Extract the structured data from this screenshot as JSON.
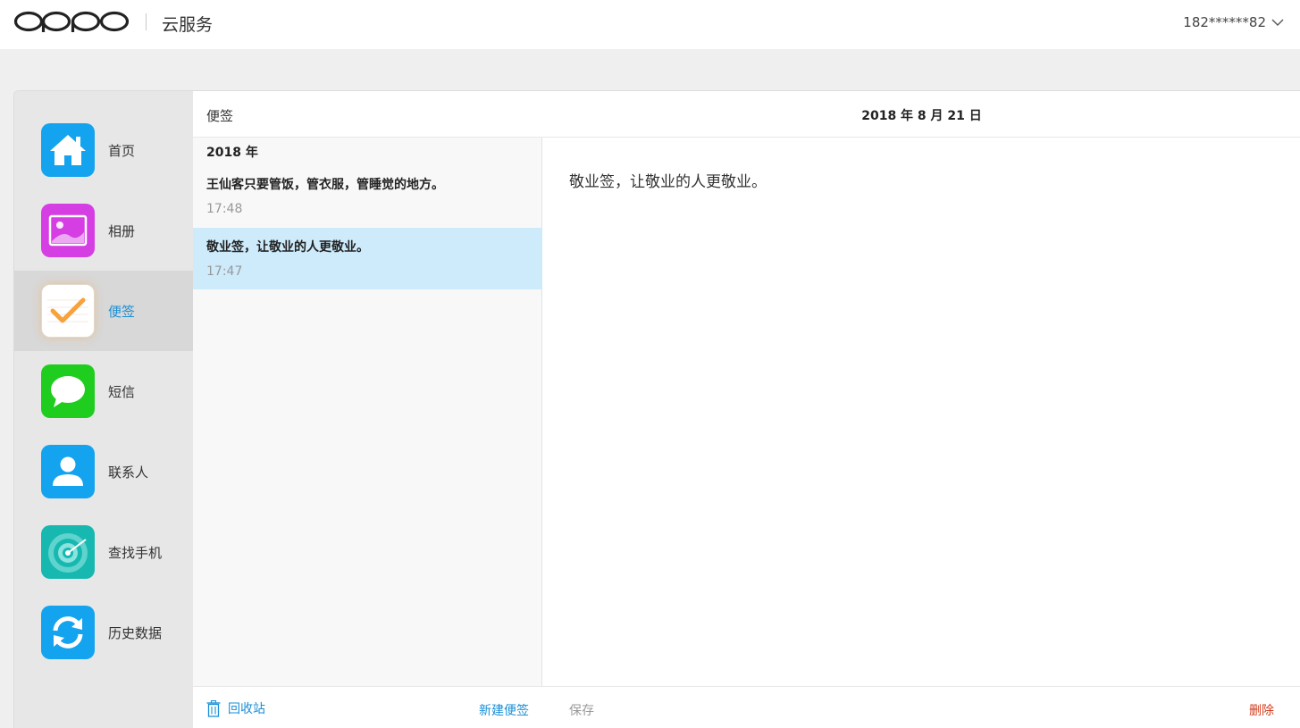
{
  "header": {
    "logo_text": "OPPO",
    "title": "云服务",
    "account": "182******82"
  },
  "sidebar": {
    "items": [
      {
        "label": "首页",
        "icon": "home-icon",
        "color": "#14a3ee"
      },
      {
        "label": "相册",
        "icon": "photo-icon",
        "color": "#d53ee3"
      },
      {
        "label": "便签",
        "icon": "notes-check-icon",
        "color": "#ffffff",
        "active": true
      },
      {
        "label": "短信",
        "icon": "message-bubble-icon",
        "color": "#1fcd1f"
      },
      {
        "label": "联系人",
        "icon": "person-icon",
        "color": "#14a3ee"
      },
      {
        "label": "查找手机",
        "icon": "radar-icon",
        "color": "#17b8b0"
      },
      {
        "label": "历史数据",
        "icon": "sync-icon",
        "color": "#14a3ee"
      }
    ]
  },
  "list": {
    "title": "便签",
    "year": "2018 年",
    "notes": [
      {
        "title": "王仙客只要管饭，管衣服，管睡觉的地方。",
        "time": "17:48"
      },
      {
        "title": "敬业签，让敬业的人更敬业。",
        "time": "17:47",
        "selected": true
      }
    ],
    "trash_label": "回收站",
    "new_label": "新建便签"
  },
  "detail": {
    "date": "2018 年 8 月 21 日",
    "content": "敬业签，让敬业的人更敬业。",
    "save_label": "保存",
    "delete_label": "删除"
  },
  "colors": {
    "accent": "#1a8fd6",
    "selected_row": "#cdebfb",
    "delete": "#d23b1c"
  }
}
